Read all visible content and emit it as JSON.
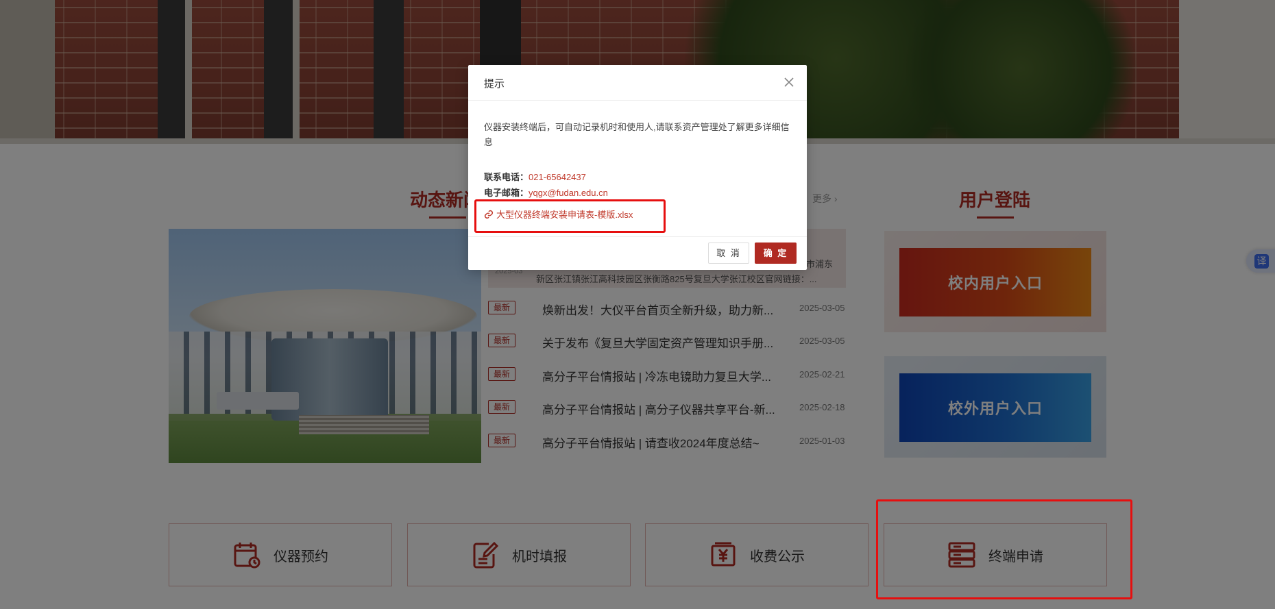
{
  "news": {
    "section_title": "动态新闻",
    "more_label": "更多 ›",
    "featured": {
      "date": "2025-03",
      "tail": "市浦东",
      "desc": "新区张江镇张江高科技园区张衡路825号复旦大学张江校区官网链接：..."
    },
    "items": [
      {
        "tag": "最新",
        "title": "焕新出发！大仪平台首页全新升级，助力新...",
        "date": "2025-03-05"
      },
      {
        "tag": "最新",
        "title": "关于发布《复旦大学固定资产管理知识手册...",
        "date": "2025-03-05"
      },
      {
        "tag": "最新",
        "title": "高分子平台情报站 | 冷冻电镜助力复旦大学...",
        "date": "2025-02-21"
      },
      {
        "tag": "最新",
        "title": "高分子平台情报站 | 高分子仪器共享平台-新...",
        "date": "2025-02-18"
      },
      {
        "tag": "最新",
        "title": "高分子平台情报站 | 请查收2024年度总结~",
        "date": "2025-01-03"
      }
    ]
  },
  "login": {
    "section_title": "用户登陆",
    "inside_label": "校内用户入口",
    "outside_label": "校外用户入口"
  },
  "quick_links": [
    {
      "label": "仪器预约",
      "icon": "calendar-clock-icon"
    },
    {
      "label": "机时填报",
      "icon": "edit-document-icon"
    },
    {
      "label": "收费公示",
      "icon": "yuan-fee-icon"
    },
    {
      "label": "终端申请",
      "icon": "server-terminal-icon"
    }
  ],
  "translate_label": "译",
  "modal": {
    "title": "提示",
    "message": "仪器安装终端后，可自动记录机时和使用人,请联系资产管理处了解更多详细信息",
    "phone_label": "联系电话：",
    "phone_value": "021-65642437",
    "email_label": "电子邮箱：",
    "email_value": "yqgx@fudan.edu.cn",
    "file_label": "大型仪器终端安装申请表-模版.xlsx",
    "cancel_label": "取 消",
    "confirm_label": "确 定"
  },
  "colors": {
    "brand_red": "#b02a22",
    "highlight_red": "#e60f0f",
    "inside_gradient_start": "#cc2b1f",
    "outside_gradient_start": "#0e45b8"
  }
}
